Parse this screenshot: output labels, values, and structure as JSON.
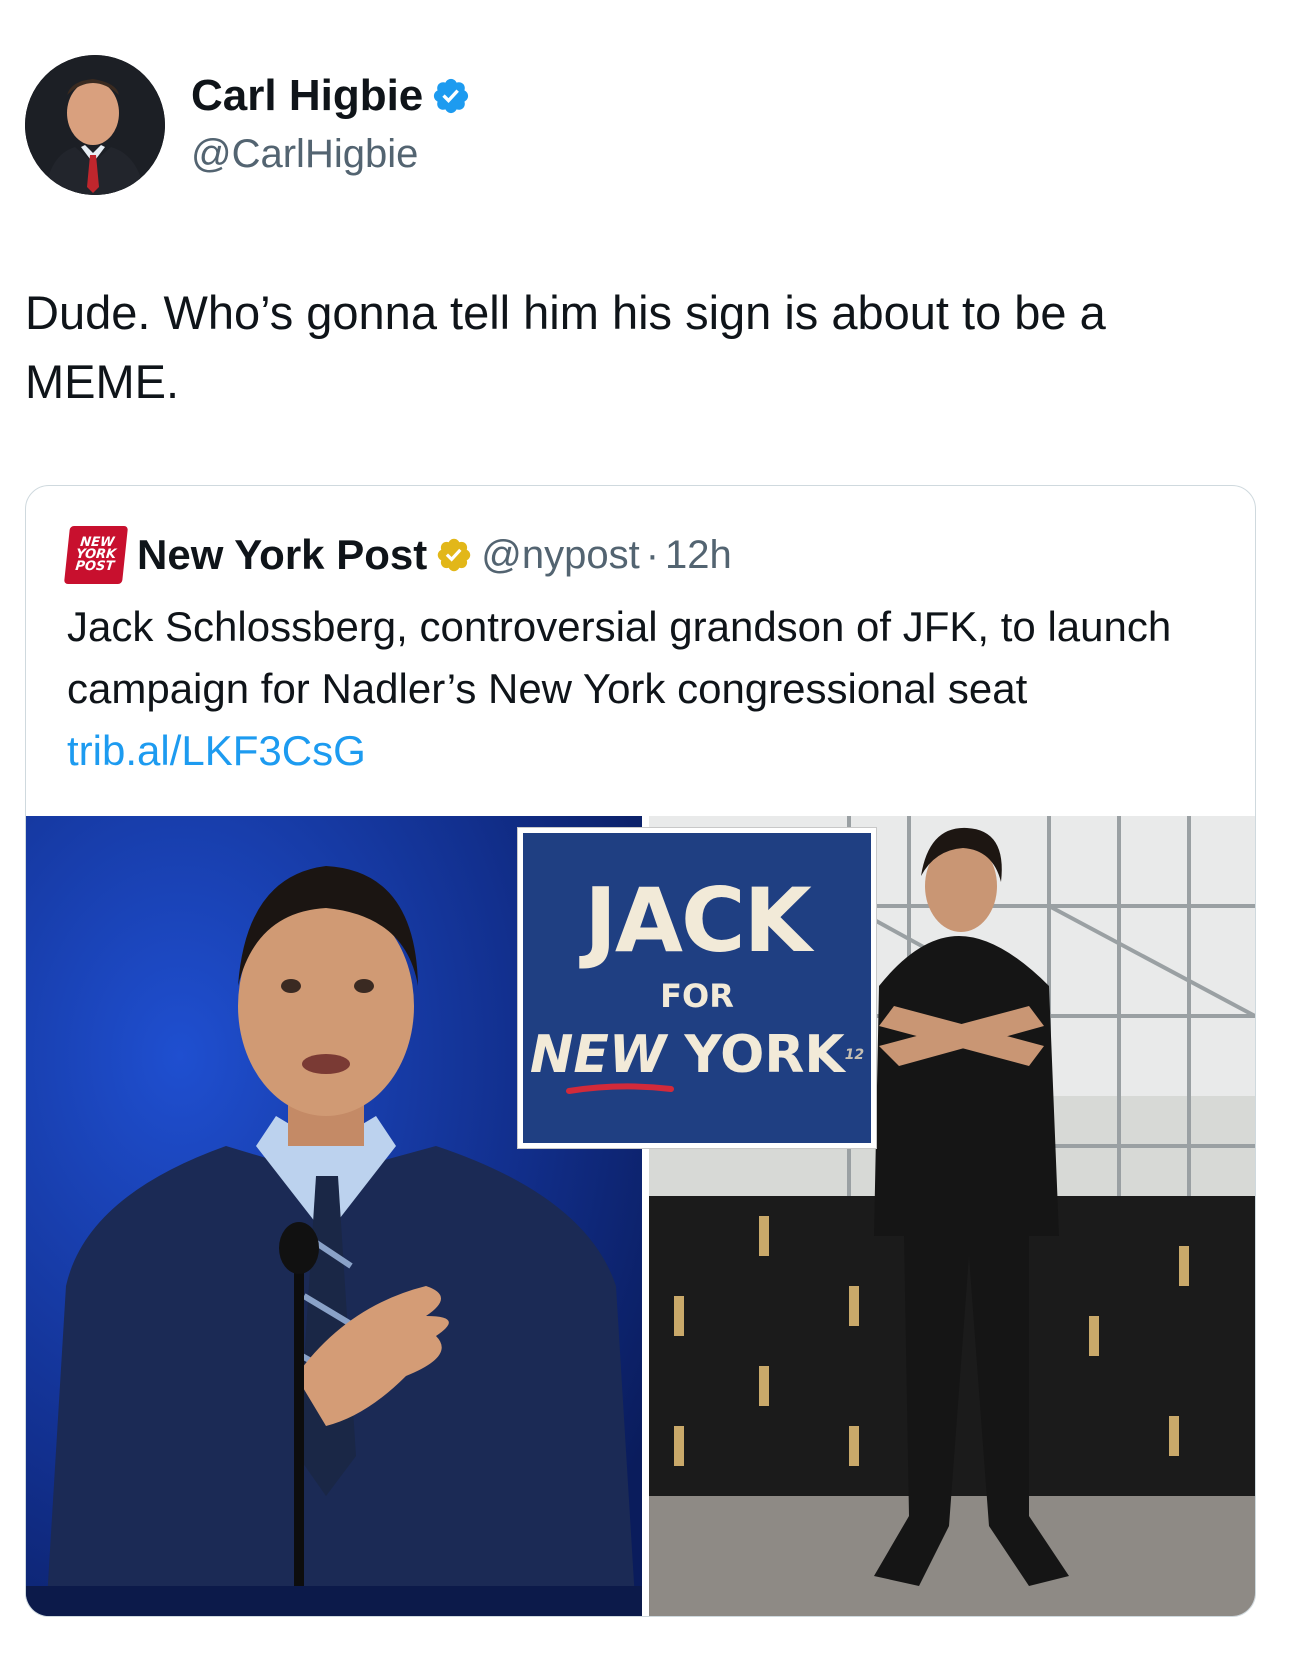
{
  "author": {
    "name": "Carl Higbie",
    "handle": "@CarlHigbie",
    "verified": true,
    "verified_color": "#1d9bf0"
  },
  "tweet": {
    "text": "Dude. Who’s gonna tell him his sign is about to be a MEME."
  },
  "quote": {
    "source_logo_lines": [
      "NEW",
      "YORK",
      "POST"
    ],
    "name": "New York Post",
    "verified_color": "#e2b719",
    "handle": "@nypost",
    "separator": "·",
    "time": "12h",
    "text": "Jack Schlossberg, controversial grandson of JFK, to launch campaign for Nadler’s New York congressional seat ",
    "link": "trib.al/LKF3CsG",
    "sign": {
      "line1": "JACK",
      "line2": "FOR",
      "line3a": "NEW",
      "line3b": " YORK",
      "superscript": "12"
    }
  }
}
